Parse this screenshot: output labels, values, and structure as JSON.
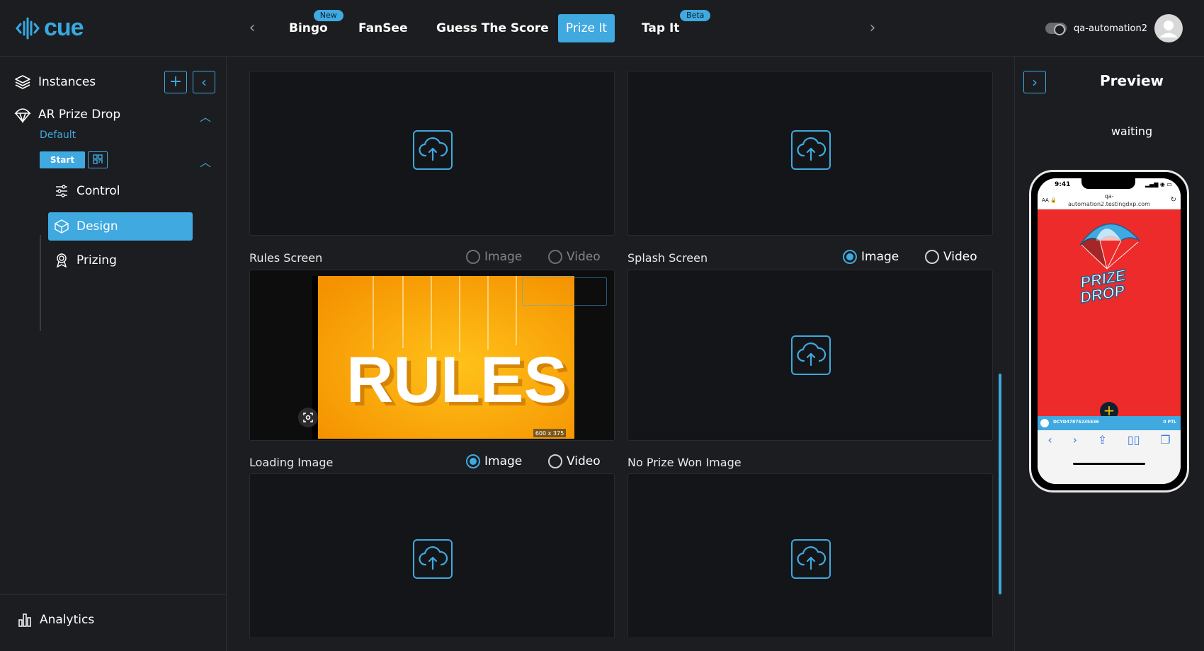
{
  "header": {
    "logo_text": "cue",
    "tabs": [
      {
        "label": "Bingo",
        "badge": "New"
      },
      {
        "label": "FanSee",
        "badge": ""
      },
      {
        "label": "Guess The Score",
        "badge": ""
      },
      {
        "label": "Prize It",
        "badge": ""
      },
      {
        "label": "Tap It",
        "badge": "Beta"
      }
    ],
    "active_tab": "Prize It",
    "username": "qa-automation2"
  },
  "sidebar": {
    "instances_label": "Instances",
    "game_label": "AR Prize Drop",
    "instance_name": "Default",
    "start_label": "Start",
    "items": [
      {
        "label": "Control",
        "icon": "sliders-icon"
      },
      {
        "label": "Design",
        "icon": "cube-icon"
      },
      {
        "label": "Prizing",
        "icon": "award-icon"
      }
    ],
    "active_item": "Design",
    "analytics_label": "Analytics"
  },
  "main": {
    "rules_screen": {
      "label": "Rules Screen",
      "image_label": "Image",
      "video_label": "Video",
      "image_text": "RULES",
      "image_size": "600 x 375"
    },
    "splash_screen": {
      "label": "Splash Screen",
      "image_label": "Image",
      "video_label": "Video"
    },
    "loading_image": {
      "label": "Loading Image",
      "image_label": "Image",
      "video_label": "Video"
    },
    "no_prize_won": {
      "label": "No Prize Won Image"
    }
  },
  "preview": {
    "title": "Preview",
    "status": "waiting",
    "phone": {
      "time": "9:41",
      "url_line1": "qa-",
      "url_line2": "automation2.testingdxp.com",
      "brand_line1": "PRIZE",
      "brand_line2": "DROP",
      "device_id": "DCYD47875235536",
      "points": "0 PTL"
    }
  },
  "colors": {
    "accent": "#3fa9e0",
    "background": "#1c1d20",
    "card": "#141518",
    "phone_red": "#ed2b2b",
    "rules_orange": "#f7a400"
  }
}
